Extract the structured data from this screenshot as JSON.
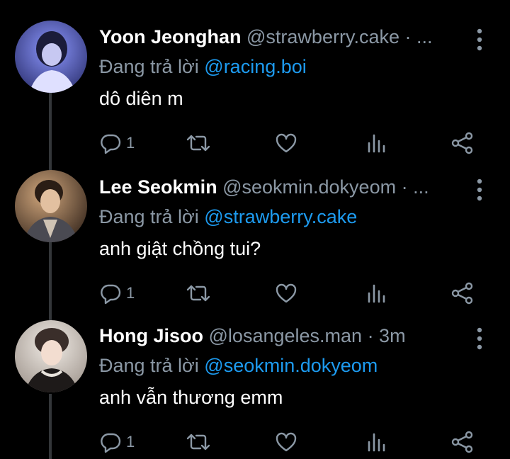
{
  "reply_prefix": "Đang trả lời",
  "tweets": [
    {
      "name": "Yoon Jeonghan",
      "handle": "@strawberry.cake",
      "time": "· ...",
      "reply_to": "@racing.boi",
      "text": "dô diên m",
      "reply_count": "1",
      "avatar_colors": [
        "#6b78f0",
        "#2b2f6e"
      ]
    },
    {
      "name": "Lee Seokmin",
      "handle": "@seokmin.dokyeom",
      "time": "· ...",
      "reply_to": "@strawberry.cake",
      "text": "anh giật chồng tui?",
      "reply_count": "1",
      "avatar_colors": [
        "#b08968",
        "#3a2a1f"
      ]
    },
    {
      "name": "Hong Jisoo",
      "handle": "@losangeles.man",
      "time": "· 3m",
      "reply_to": "@seokmin.dokyeom",
      "text": "anh vẫn thương emm",
      "reply_count": "1",
      "avatar_colors": [
        "#d8d2cc",
        "#2a2220"
      ]
    }
  ],
  "colors": {
    "muted": "#8b98a5",
    "link": "#1d9bf0",
    "background": "#000000",
    "thread_line": "#333639"
  },
  "icons": [
    "reply-icon",
    "retweet-icon",
    "like-icon",
    "analytics-icon",
    "share-icon",
    "more-icon"
  ]
}
